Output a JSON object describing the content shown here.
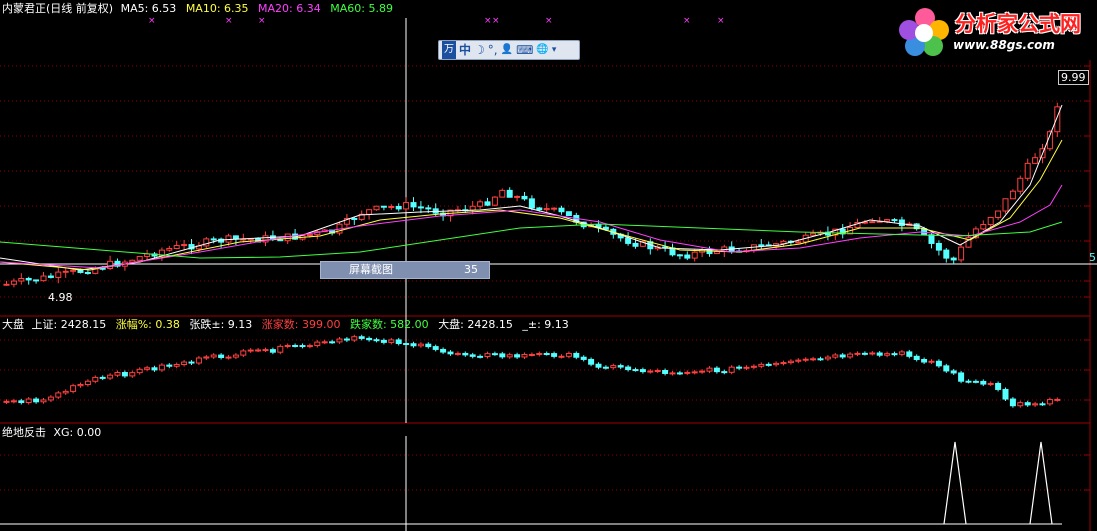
{
  "main_panel": {
    "title": "内蒙君正(日线 前复权)",
    "ma5": "MA5: 6.53",
    "ma10": "MA10: 6.35",
    "ma20": "MA20: 6.34",
    "ma60": "MA60: 5.89",
    "high_label": "9.99",
    "low_label": "4.98",
    "right_edge_label": "5"
  },
  "toolbar": {
    "items": [
      "万",
      "中",
      "☽",
      "°,",
      "👤",
      "⌨",
      "🌐",
      "▾"
    ]
  },
  "popup": {
    "label": "屏幕截图",
    "value": "35"
  },
  "index_panel": {
    "name": "大盘",
    "index_label": "上证: 2428.15",
    "change_pct_label": "涨幅%: 0.38",
    "change_label": "张跌±: 9.13",
    "up_count_label": "涨家数: 399.00",
    "down_count_label": "跌家数: 582.00",
    "dapan_label": "大盘: 2428.15",
    "pm_label": "_±: 9.13"
  },
  "indicator_panel": {
    "title": "绝地反击",
    "xg_label": "XG: 0.00"
  },
  "logo": {
    "text": "分析家公式网",
    "url_text": "www.88gs.com"
  },
  "colors": {
    "up": "#ff4040",
    "down": "#54ffff",
    "ma5": "#ffffff",
    "ma10": "#ffff40",
    "ma20": "#ff40ff",
    "ma60": "#40ff40",
    "grid": "#8b0000"
  }
}
